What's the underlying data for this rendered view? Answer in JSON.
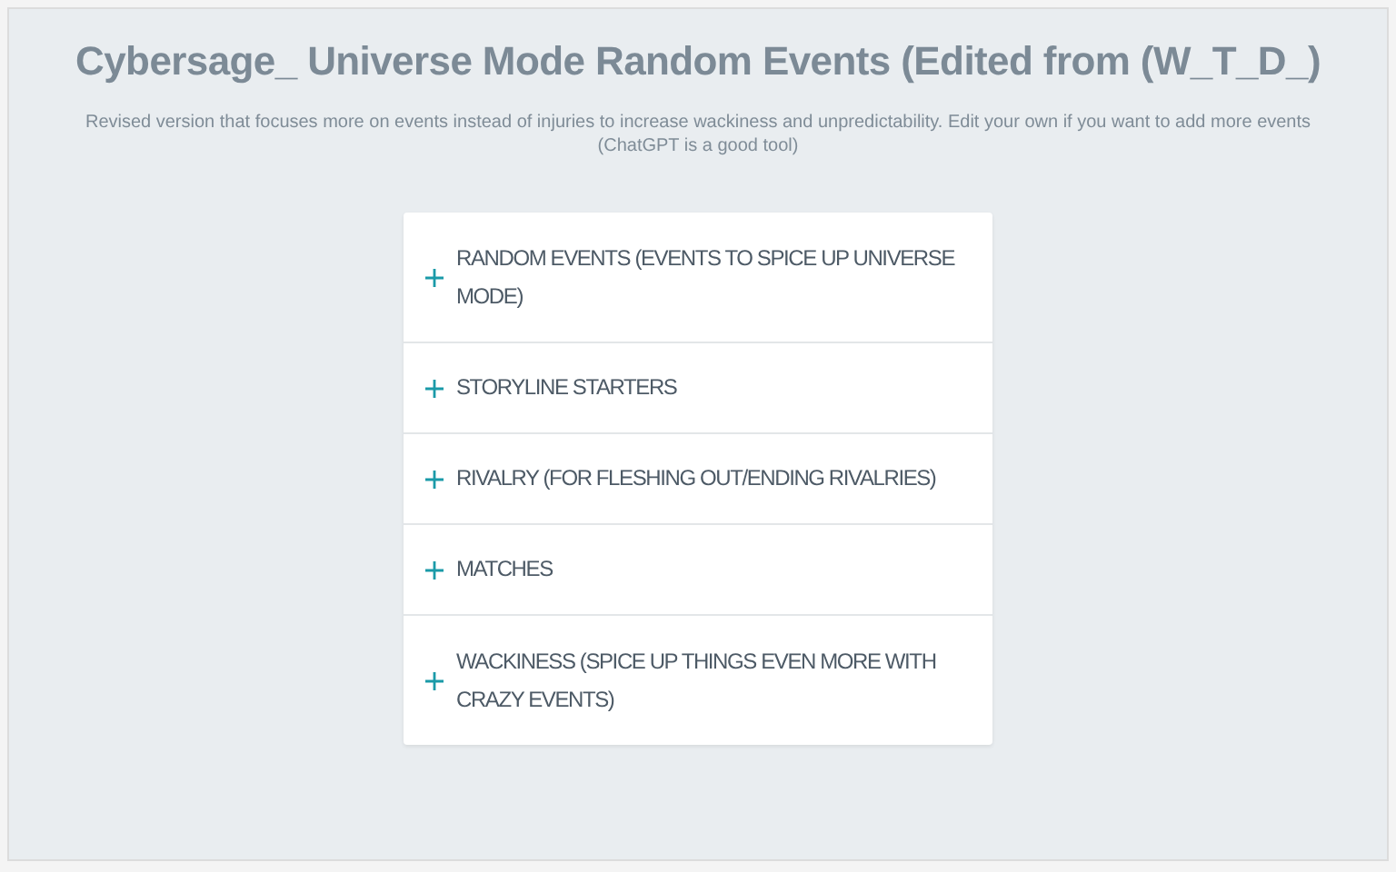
{
  "title": "Cybersage_ Universe Mode Random Events (Edited from (W_T_D_)",
  "description": "Revised version that focuses more on events instead of injuries to increase wackiness and unpredictability. Edit your own if you want to add more events (ChatGPT is a good tool)",
  "sections": [
    {
      "label": "RANDOM EVENTS (EVENTS TO SPICE UP UNIVERSE MODE)",
      "expanded": false
    },
    {
      "label": "STORYLINE STARTERS",
      "expanded": false
    },
    {
      "label": "RIVALRY (FOR FLESHING OUT/ENDING RIVALRIES)",
      "expanded": false
    },
    {
      "label": "MATCHES",
      "expanded": false
    },
    {
      "label": "WACKINESS (SPICE UP THINGS EVEN MORE WITH CRAZY EVENTS)",
      "expanded": false
    }
  ]
}
